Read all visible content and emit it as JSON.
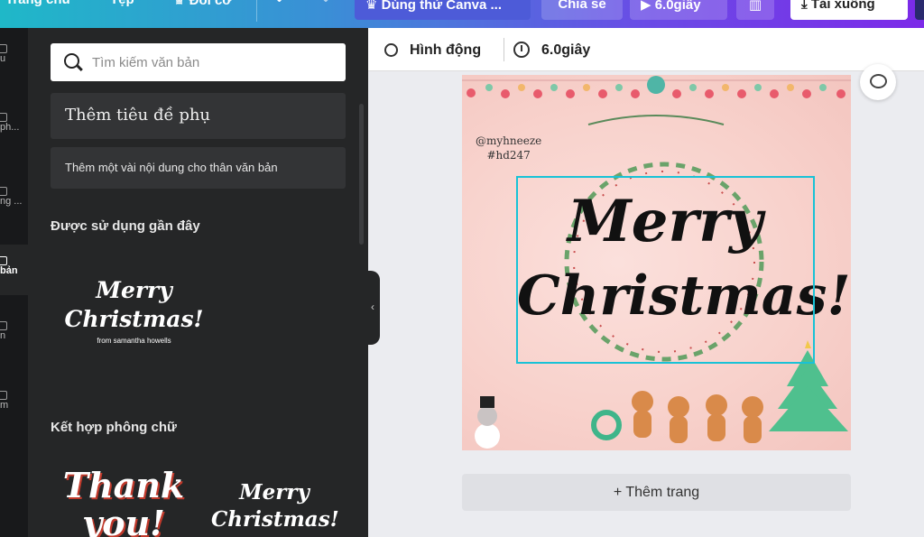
{
  "topbar": {
    "home": "Trang chủ",
    "file": "Tệp",
    "resize": "Đổi cỡ",
    "try_canva": "Dùng thử Canva ...",
    "share": "Chia sẻ",
    "play": "6.0giây",
    "download": "Tải xuống"
  },
  "rail": {
    "items": [
      "u",
      "ph...",
      "ng ...",
      "bản",
      "n",
      "m"
    ]
  },
  "panel": {
    "search_placeholder": "Tìm kiếm văn bản",
    "add_subtitle": "Thêm tiêu đề phụ",
    "add_body": "Thêm một vài nội dung cho thân văn bản",
    "recent_heading": "Được sử dụng gần đây",
    "recent_sample": {
      "line1": "Merry",
      "line2": "Christmas!",
      "line3": "from samantha howells"
    },
    "combo_heading": "Kết hợp phông chữ",
    "combo_1": {
      "line1": "Thank",
      "line2": "you!"
    },
    "combo_2": {
      "line1": "Merry",
      "line2": "Christmas!"
    }
  },
  "editor": {
    "animate_label": "Hình động",
    "duration_label": "6.0giây",
    "add_page": "+ Thêm trang"
  },
  "design": {
    "credit_line1": "@myhneeze",
    "credit_line2": "#hd247",
    "headline_line1": "Merry",
    "headline_line2": "Christmas!"
  },
  "colors": {
    "selection": "#19c2d6",
    "panel": "#252627",
    "canvas_bg": "#f8d2cc"
  }
}
